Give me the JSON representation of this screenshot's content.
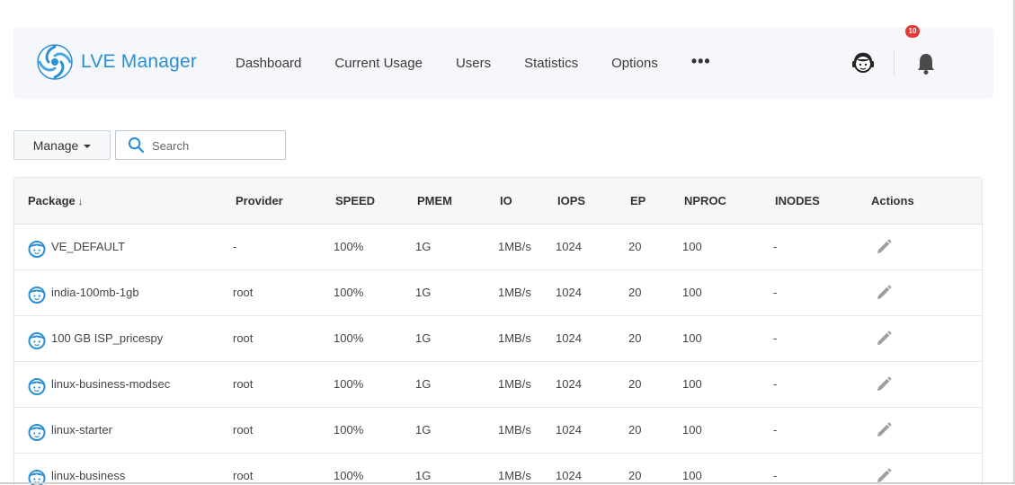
{
  "app": {
    "title": "LVE Manager",
    "accent_color": "#2b8fd6"
  },
  "nav": {
    "items": [
      {
        "label": "Dashboard"
      },
      {
        "label": "Current Usage"
      },
      {
        "label": "Users"
      },
      {
        "label": "Statistics"
      },
      {
        "label": "Options"
      }
    ],
    "more_label": "•••"
  },
  "header": {
    "support_icon": "support-agent-icon",
    "notifications_icon": "bell-icon",
    "notifications_count": "10"
  },
  "toolbar": {
    "manage_label": "Manage",
    "search_placeholder": "Search",
    "search_value": ""
  },
  "table": {
    "columns": {
      "package": "Package",
      "package_sort": "↓",
      "provider": "Provider",
      "speed": "SPEED",
      "pmem": "PMEM",
      "io": "IO",
      "iops": "IOPS",
      "ep": "EP",
      "nproc": "NPROC",
      "inodes": "INODES",
      "actions": "Actions"
    },
    "rows": [
      {
        "package": "VE_DEFAULT",
        "provider": "-",
        "speed": "100%",
        "pmem": "1G",
        "io": "1MB/s",
        "iops": "1024",
        "ep": "20",
        "nproc": "100",
        "inodes": "-"
      },
      {
        "package": "india-100mb-1gb",
        "provider": "root",
        "speed": "100%",
        "pmem": "1G",
        "io": "1MB/s",
        "iops": "1024",
        "ep": "20",
        "nproc": "100",
        "inodes": "-"
      },
      {
        "package": "100 GB ISP_pricespy",
        "provider": "root",
        "speed": "100%",
        "pmem": "1G",
        "io": "1MB/s",
        "iops": "1024",
        "ep": "20",
        "nproc": "100",
        "inodes": "-"
      },
      {
        "package": "linux-business-modsec",
        "provider": "root",
        "speed": "100%",
        "pmem": "1G",
        "io": "1MB/s",
        "iops": "1024",
        "ep": "20",
        "nproc": "100",
        "inodes": "-"
      },
      {
        "package": "linux-starter",
        "provider": "root",
        "speed": "100%",
        "pmem": "1G",
        "io": "1MB/s",
        "iops": "1024",
        "ep": "20",
        "nproc": "100",
        "inodes": "-"
      },
      {
        "package": "linux-business",
        "provider": "root",
        "speed": "100%",
        "pmem": "1G",
        "io": "1MB/s",
        "iops": "1024",
        "ep": "20",
        "nproc": "100",
        "inodes": "-"
      }
    ],
    "row_icon": "package-face-icon",
    "action_icon": "edit-pencil-icon"
  }
}
